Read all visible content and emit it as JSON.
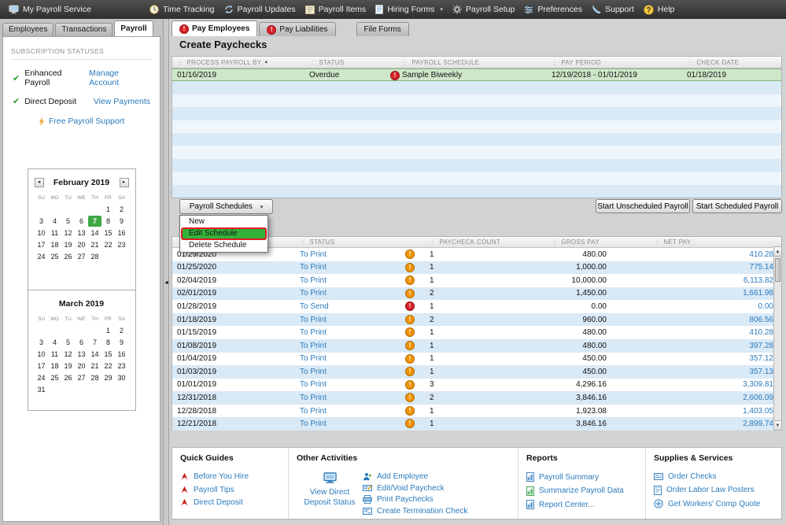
{
  "topbar": {
    "items": [
      {
        "label": "My Payroll Service",
        "icon": "computer-icon"
      },
      {
        "label": "Time Tracking",
        "icon": "clock-icon"
      },
      {
        "label": "Payroll Updates",
        "icon": "refresh-icon"
      },
      {
        "label": "Payroll Items",
        "icon": "list-icon"
      },
      {
        "label": "Hiring Forms",
        "icon": "form-icon",
        "caret": true
      },
      {
        "label": "Payroll Setup",
        "icon": "gear-icon"
      },
      {
        "label": "Preferences",
        "icon": "sliders-icon"
      },
      {
        "label": "Support",
        "icon": "phone-icon"
      },
      {
        "label": "Help",
        "icon": "help-icon"
      }
    ]
  },
  "sidebar": {
    "tabs": [
      {
        "label": "Employees",
        "active": false
      },
      {
        "label": "Transactions",
        "active": false
      },
      {
        "label": "Payroll",
        "active": true
      }
    ],
    "subscription": {
      "heading": "SUBSCRIPTION STATUSES",
      "rows": [
        {
          "status": "Enhanced Payroll",
          "link": "Manage Account"
        },
        {
          "status": "Direct Deposit",
          "link": "View Payments"
        }
      ],
      "support_link": "Free Payroll Support"
    },
    "calendars": [
      {
        "title": "February 2019",
        "nav": true,
        "day_headers": [
          "SU",
          "MO",
          "TU",
          "WE",
          "TH",
          "FR",
          "SA"
        ],
        "weeks": [
          [
            "",
            "",
            "",
            "",
            "",
            "1",
            "2"
          ],
          [
            "3",
            "4",
            "5",
            "6",
            "7",
            "8",
            "9"
          ],
          [
            "10",
            "11",
            "12",
            "13",
            "14",
            "15",
            "16"
          ],
          [
            "17",
            "18",
            "19",
            "20",
            "21",
            "22",
            "23"
          ],
          [
            "24",
            "25",
            "26",
            "27",
            "28",
            "",
            ""
          ]
        ],
        "highlight": "7"
      },
      {
        "title": "March 2019",
        "nav": false,
        "day_headers": [
          "SU",
          "MO",
          "TU",
          "WE",
          "TH",
          "FR",
          "SA"
        ],
        "weeks": [
          [
            "",
            "",
            "",
            "",
            "",
            "1",
            "2"
          ],
          [
            "3",
            "4",
            "5",
            "6",
            "7",
            "8",
            "9"
          ],
          [
            "10",
            "11",
            "12",
            "13",
            "14",
            "15",
            "16"
          ],
          [
            "17",
            "18",
            "19",
            "20",
            "21",
            "22",
            "23"
          ],
          [
            "24",
            "25",
            "26",
            "27",
            "28",
            "29",
            "30"
          ],
          [
            "31",
            "",
            "",
            "",
            "",
            "",
            ""
          ]
        ],
        "highlight": ""
      }
    ]
  },
  "main": {
    "tabs": [
      {
        "label": "Pay Employees",
        "alert": true,
        "active": true
      },
      {
        "label": "Pay Liabilities",
        "alert": true,
        "active": false
      },
      {
        "label": "File Forms",
        "alert": false,
        "active": false
      }
    ],
    "title": "Create Paychecks",
    "paychecks_table": {
      "columns": [
        "PROCESS PAYROLL BY",
        "STATUS",
        "PAYROLL SCHEDULE",
        "PAY PERIOD",
        "CHECK DATE"
      ],
      "sort_column": 0,
      "rows": [
        {
          "process_by": "01/16/2019",
          "status": "Overdue",
          "alert": "red",
          "schedule": "Sample Biweekly",
          "period": "12/19/2018 - 01/01/2019",
          "check_date": "01/18/2019",
          "selected": true
        }
      ],
      "empty_row_count": 9
    },
    "schedules_button": "Payroll Schedules",
    "schedules_menu": [
      "New",
      "Edit Schedule",
      "Delete Schedule"
    ],
    "highlighted_menu_item": "Edit Schedule",
    "action_buttons": [
      "Start Unscheduled Payroll",
      "Start Scheduled Payroll"
    ],
    "recent_table": {
      "columns": [
        "",
        "STATUS",
        "PAYCHECK COUNT",
        "GROSS PAY",
        "NET PAY"
      ],
      "rows": [
        {
          "date": "01/29/2020",
          "status": "To Print",
          "alert": "orange",
          "count": "1",
          "gross": "480.00",
          "net": "410.28"
        },
        {
          "date": "01/25/2020",
          "status": "To Print",
          "alert": "orange",
          "count": "1",
          "gross": "1,000.00",
          "net": "775.14"
        },
        {
          "date": "02/04/2019",
          "status": "To Print",
          "alert": "orange",
          "count": "1",
          "gross": "10,000.00",
          "net": "6,113.82"
        },
        {
          "date": "02/01/2019",
          "status": "To Print",
          "alert": "orange",
          "count": "2",
          "gross": "1,450.00",
          "net": "1,661.98"
        },
        {
          "date": "01/28/2019",
          "status": "To Send",
          "alert": "red",
          "count": "1",
          "gross": "0.00",
          "net": "0.00"
        },
        {
          "date": "01/18/2019",
          "status": "To Print",
          "alert": "orange",
          "count": "2",
          "gross": "960.00",
          "net": "806.56"
        },
        {
          "date": "01/15/2019",
          "status": "To Print",
          "alert": "orange",
          "count": "1",
          "gross": "480.00",
          "net": "410.28"
        },
        {
          "date": "01/08/2019",
          "status": "To Print",
          "alert": "orange",
          "count": "1",
          "gross": "480.00",
          "net": "397.28"
        },
        {
          "date": "01/04/2019",
          "status": "To Print",
          "alert": "orange",
          "count": "1",
          "gross": "450.00",
          "net": "357.12"
        },
        {
          "date": "01/03/2019",
          "status": "To Print",
          "alert": "orange",
          "count": "1",
          "gross": "450.00",
          "net": "357.13"
        },
        {
          "date": "01/01/2019",
          "status": "To Print",
          "alert": "orange",
          "count": "3",
          "gross": "4,296.16",
          "net": "3,309.81"
        },
        {
          "date": "12/31/2018",
          "status": "To Print",
          "alert": "orange",
          "count": "2",
          "gross": "3,846.16",
          "net": "2,606.09"
        },
        {
          "date": "12/28/2018",
          "status": "To Print",
          "alert": "orange",
          "count": "1",
          "gross": "1,923.08",
          "net": "1,403.05"
        },
        {
          "date": "12/21/2018",
          "status": "To Print",
          "alert": "orange",
          "count": "1",
          "gross": "3,846.16",
          "net": "2,899.74"
        }
      ]
    },
    "bottom": {
      "sections": [
        {
          "heading": "Quick Guides",
          "items": [
            {
              "label": "Before You Hire",
              "icon": "pdf-icon"
            },
            {
              "label": "Payroll Tips",
              "icon": "pdf-icon"
            },
            {
              "label": "Direct Deposit",
              "icon": "pdf-icon"
            }
          ]
        },
        {
          "heading": "Other Activities",
          "featured": {
            "label": "View Direct Deposit Status",
            "icon": "monitor-icon"
          },
          "items": [
            {
              "label": "Add Employee",
              "icon": "add-employee-icon"
            },
            {
              "label": "Edit/Void Paycheck",
              "icon": "edit-check-icon"
            },
            {
              "label": "Print Paychecks",
              "icon": "print-icon"
            },
            {
              "label": "Create Termination Check",
              "icon": "termination-check-icon"
            }
          ]
        },
        {
          "heading": "Reports",
          "items": [
            {
              "label": "Payroll Summary",
              "icon": "report-blue-icon"
            },
            {
              "label": "Summarize Payroll Data",
              "icon": "report-green-icon"
            },
            {
              "label": "Report Center...",
              "icon": "report-blue-icon"
            }
          ]
        },
        {
          "heading": "Supplies & Services",
          "items": [
            {
              "label": "Order Checks",
              "icon": "checks-icon"
            },
            {
              "label": "Order Labor Law Posters",
              "icon": "poster-icon"
            },
            {
              "label": "Get Workers' Comp Quote",
              "icon": "comp-quote-icon"
            }
          ]
        }
      ]
    }
  },
  "colors": {
    "accent_blue": "#2b7bbd",
    "alert_red": "#d8232a",
    "alert_orange": "#f19204",
    "selected_row_green": "#cfe7c9",
    "menu_highlight_green": "#33b23a",
    "annotation_border_red": "#e01b23",
    "row_alt_blue": "#d9e9f6"
  }
}
